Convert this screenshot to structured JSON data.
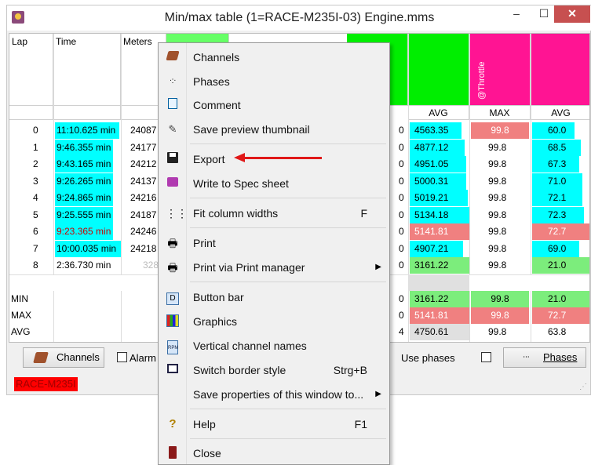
{
  "window": {
    "title": "Min/max table (1=RACE-M235I-03)   Engine.mms",
    "min_glyph": "–",
    "max_glyph": "☐",
    "close_glyph": "✕"
  },
  "columns": {
    "lap": "Lap",
    "time": "Time",
    "meters": "Meters",
    "throttle": "@Throttle",
    "sub_avg1": "AVG",
    "sub_max": "MAX",
    "sub_avg2": "AVG"
  },
  "rows": [
    {
      "lap": "0",
      "time": "11:10.625 min",
      "meters": "24087",
      "avg1": "4563.35",
      "max": "99.8",
      "avg2": "60.0",
      "left": "0"
    },
    {
      "lap": "1",
      "time": "9:46.355 min",
      "meters": "24177",
      "avg1": "4877.12",
      "max": "99.8",
      "avg2": "68.5",
      "left": "0"
    },
    {
      "lap": "2",
      "time": "9:43.165 min",
      "meters": "24212",
      "avg1": "4951.05",
      "max": "99.8",
      "avg2": "67.3",
      "left": "0"
    },
    {
      "lap": "3",
      "time": "9:26.265 min",
      "meters": "24137",
      "avg1": "5000.31",
      "max": "99.8",
      "avg2": "71.0",
      "left": "0"
    },
    {
      "lap": "4",
      "time": "9:24.865 min",
      "meters": "24216",
      "avg1": "5019.21",
      "max": "99.8",
      "avg2": "72.1",
      "left": "0"
    },
    {
      "lap": "5",
      "time": "9:25.555 min",
      "meters": "24187",
      "avg1": "5134.18",
      "max": "99.8",
      "avg2": "72.3",
      "left": "0"
    },
    {
      "lap": "6",
      "time": "9:23.365 min",
      "meters": "24246",
      "avg1": "5141.81",
      "max": "99.8",
      "avg2": "72.7",
      "left": "0"
    },
    {
      "lap": "7",
      "time": "10:00.035 min",
      "meters": "24218",
      "avg1": "4907.21",
      "max": "99.8",
      "avg2": "69.0",
      "left": "0"
    },
    {
      "lap": "8",
      "time": "2:36.730 min",
      "meters": "3280",
      "avg1": "3161.22",
      "max": "99.8",
      "avg2": "21.0",
      "left": "0"
    }
  ],
  "summary": [
    {
      "label": "MIN",
      "left": "0",
      "avg1": "3161.22",
      "max": "99.8",
      "avg2": "21.0"
    },
    {
      "label": "MAX",
      "left": "0",
      "avg1": "5141.81",
      "max": "99.8",
      "avg2": "72.7"
    },
    {
      "label": "AVG",
      "left": "4",
      "avg1": "4750.61",
      "max": "99.8",
      "avg2": "63.8"
    }
  ],
  "bottombar": {
    "channels": "Channels",
    "alarm": "Alarm",
    "use_phases": "Use phases",
    "phases": "Phases"
  },
  "status": "RACE-M235I",
  "menu": {
    "items": [
      {
        "label": "Channels",
        "shortcut": "",
        "icon": "channels-icon"
      },
      {
        "label": "Phases",
        "shortcut": "",
        "icon": "phases-icon"
      },
      {
        "label": "Comment",
        "shortcut": "",
        "icon": "comment-icon"
      },
      {
        "label": "Save preview thumbnail",
        "shortcut": "",
        "icon": "thumbnail-icon"
      },
      {
        "label": "Export",
        "shortcut": "",
        "icon": "save-disk-icon"
      },
      {
        "label": "Write to Spec sheet",
        "shortcut": "",
        "icon": "spec-sheet-icon"
      },
      {
        "label": "Fit column widths",
        "shortcut": "F",
        "icon": "fit-columns-icon"
      },
      {
        "label": "Print",
        "shortcut": "",
        "icon": "printer-icon"
      },
      {
        "label": "Print via Print manager",
        "shortcut": "",
        "icon": "printer-icon"
      },
      {
        "label": "Button bar",
        "shortcut": "",
        "icon": "button-bar-icon"
      },
      {
        "label": "Graphics",
        "shortcut": "",
        "icon": "graphics-icon"
      },
      {
        "label": "Vertical channel names",
        "shortcut": "",
        "icon": "rpm-icon"
      },
      {
        "label": "Switch border style",
        "shortcut": "Strg+B",
        "icon": "border-style-icon"
      },
      {
        "label": "Save properties of this window to...",
        "shortcut": "",
        "icon": ""
      },
      {
        "label": "Help",
        "shortcut": "F1",
        "icon": "help-icon"
      },
      {
        "label": "Close",
        "shortcut": "",
        "icon": "close-icon"
      }
    ]
  },
  "colors": {
    "cyan": "#00ffff",
    "green": "#00ee00",
    "pink": "#ff1493",
    "salmon": "#f08080",
    "red_status": "#ff0000",
    "arrow": "#e01818"
  }
}
